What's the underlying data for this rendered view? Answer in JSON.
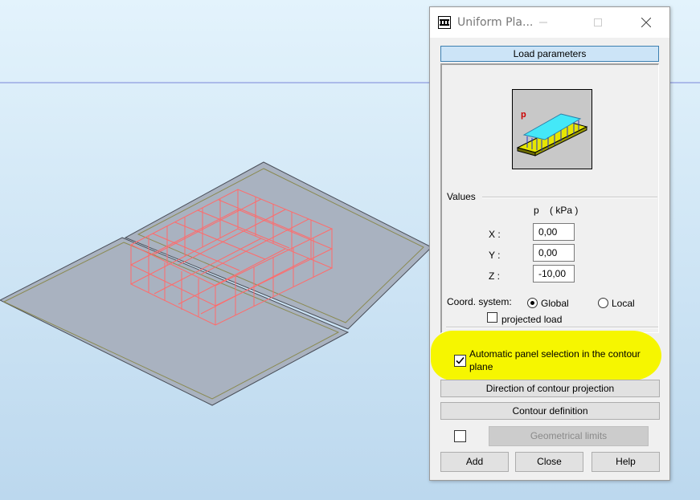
{
  "dialog": {
    "title": "Uniform Pla...",
    "load_parameters_label": "Load parameters",
    "values_heading": "Values",
    "column_header": "p    ( kPa )",
    "x_label": "X :",
    "y_label": "Y :",
    "z_label": "Z :",
    "x_value": "0,00",
    "y_value": "0,00",
    "z_value": "-10,00",
    "coord_label": "Coord. system:",
    "global_label": "Global",
    "local_label": "Local",
    "coord_selected": "Global",
    "projected_label": "projected load",
    "projected_checked": false,
    "auto_panel_line1": "Automatic panel selection in the contour",
    "auto_panel_line2": "plane",
    "auto_panel_checked": true,
    "direction_label": "Direction of contour projection",
    "contour_def_label": "Contour definition",
    "geo_limits_label": "Geometrical limits",
    "geo_limits_checked": false,
    "add_label": "Add",
    "close_label": "Close",
    "help_label": "Help",
    "illustration_letter": "p"
  },
  "icons": [
    "app-icon",
    "minimize-icon",
    "maximize-icon",
    "close-icon",
    "uniform-load-icon"
  ],
  "colors": {
    "viewport_top": "#e3f3fc",
    "viewport_bottom": "#bcd8ee",
    "slab": "#a9b2c0",
    "wireframe": "#ff6b6b",
    "highlight": "#f6f600",
    "load_plane": "#44e8f8",
    "load_arrows": "#2233cc"
  }
}
